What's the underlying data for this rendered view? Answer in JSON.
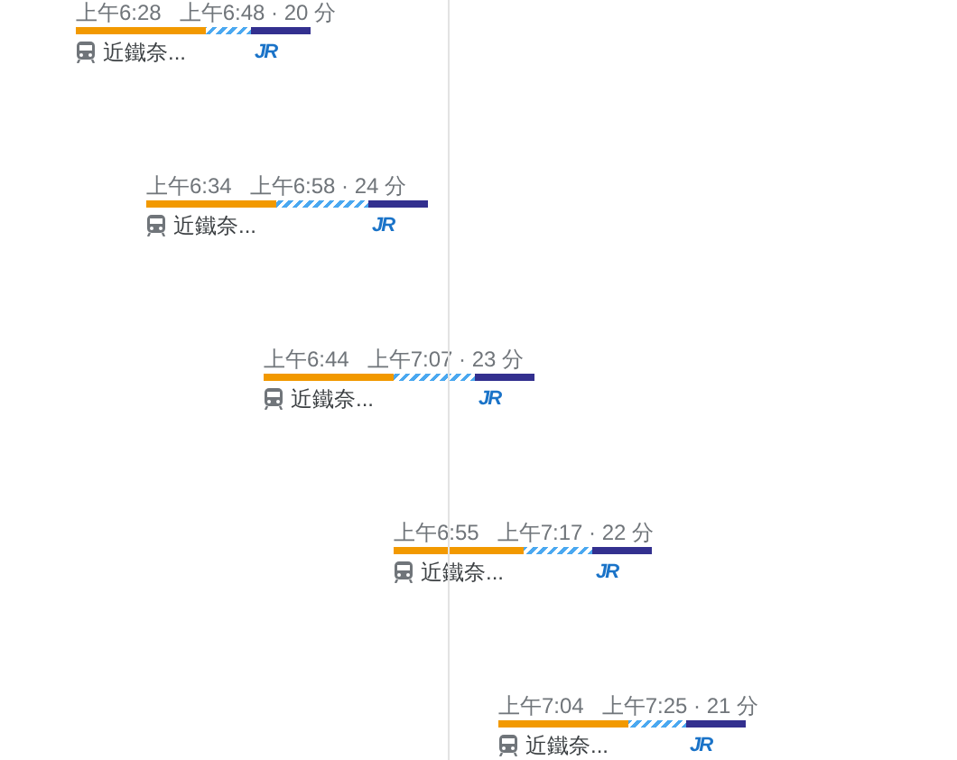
{
  "trips": [
    {
      "depart": "上午6:28",
      "arrive": "上午6:48 · 20 分",
      "segments": [
        {
          "kind": "solid",
          "color": "#f29900"
        },
        {
          "kind": "striped",
          "color": "#4aa8f0"
        },
        {
          "kind": "solid",
          "color": "#33308f"
        }
      ],
      "first_line": "近鐵奈...",
      "second_line": "JR"
    },
    {
      "depart": "上午6:34",
      "arrive": "上午6:58 · 24 分",
      "segments": [
        {
          "kind": "solid",
          "color": "#f29900"
        },
        {
          "kind": "striped",
          "color": "#4aa8f0"
        },
        {
          "kind": "solid",
          "color": "#33308f"
        }
      ],
      "first_line": "近鐵奈...",
      "second_line": "JR"
    },
    {
      "depart": "上午6:44",
      "arrive": "上午7:07 · 23 分",
      "segments": [
        {
          "kind": "solid",
          "color": "#f29900"
        },
        {
          "kind": "striped",
          "color": "#4aa8f0"
        },
        {
          "kind": "solid",
          "color": "#33308f"
        }
      ],
      "first_line": "近鐵奈...",
      "second_line": "JR"
    },
    {
      "depart": "上午6:55",
      "arrive": "上午7:17 · 22 分",
      "segments": [
        {
          "kind": "solid",
          "color": "#f29900"
        },
        {
          "kind": "striped",
          "color": "#4aa8f0"
        },
        {
          "kind": "solid",
          "color": "#33308f"
        }
      ],
      "first_line": "近鐵奈...",
      "second_line": "JR"
    },
    {
      "depart": "上午7:04",
      "arrive": "上午7:25 · 21 分",
      "segments": [
        {
          "kind": "solid",
          "color": "#f29900"
        },
        {
          "kind": "striped",
          "color": "#4aa8f0"
        },
        {
          "kind": "solid",
          "color": "#33308f"
        }
      ],
      "first_line": "近鐵奈...",
      "second_line": "JR"
    }
  ]
}
